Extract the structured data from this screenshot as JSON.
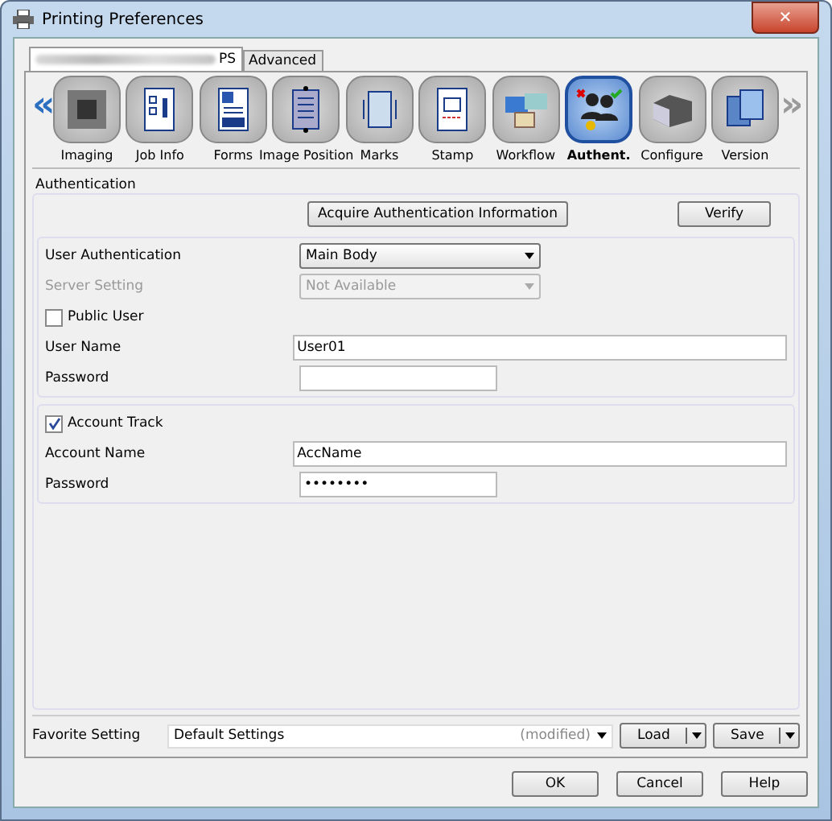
{
  "window": {
    "title": "Printing Preferences",
    "close": "✕"
  },
  "tabs": [
    {
      "label": "PS",
      "selected": true
    },
    {
      "label": "Advanced",
      "selected": false
    }
  ],
  "toolbar": {
    "back": {
      "text": "«",
      "disabled": false
    },
    "forward": {
      "text": "»",
      "disabled": true
    },
    "items": [
      {
        "label": "Imaging",
        "selected": false
      },
      {
        "label": "Job Info",
        "selected": false
      },
      {
        "label": "Forms",
        "selected": false
      },
      {
        "label": "Image Position",
        "selected": false
      },
      {
        "label": "Marks",
        "selected": false
      },
      {
        "label": "Stamp",
        "selected": false
      },
      {
        "label": "Workflow",
        "selected": false
      },
      {
        "label": "Authent.",
        "selected": true
      },
      {
        "label": "Configure",
        "selected": false
      },
      {
        "label": "Version",
        "selected": false
      }
    ]
  },
  "authentication": {
    "title": "Authentication",
    "buttons": [
      "Acquire Authentication Information",
      "Verify"
    ],
    "groups": [
      {
        "rows": [
          {
            "kind": "dropdown",
            "label": "User Authentication",
            "value": "Main Body",
            "disabled": false
          },
          {
            "kind": "dropdown",
            "label": "Server Setting",
            "value": "Not Available",
            "disabled": true
          },
          {
            "kind": "checkbox",
            "label": "Public User",
            "checked": false
          },
          {
            "kind": "text",
            "label": "User Name",
            "value": "User01"
          },
          {
            "kind": "password",
            "label": "Password"
          }
        ]
      },
      {
        "rows": [
          {
            "kind": "checkbox",
            "label": "Account Track",
            "checked": true
          },
          {
            "kind": "text",
            "label": "Account Name",
            "value": "AccName"
          },
          {
            "kind": "password",
            "label": "Password",
            "value": "••••••••"
          }
        ]
      }
    ]
  },
  "favorite": {
    "label": "Favorite Setting",
    "value": "Default Settings",
    "note": "(modified)",
    "buttons": [
      "Load",
      "Save"
    ]
  },
  "buttons": [
    "OK",
    "Cancel",
    "Help"
  ]
}
